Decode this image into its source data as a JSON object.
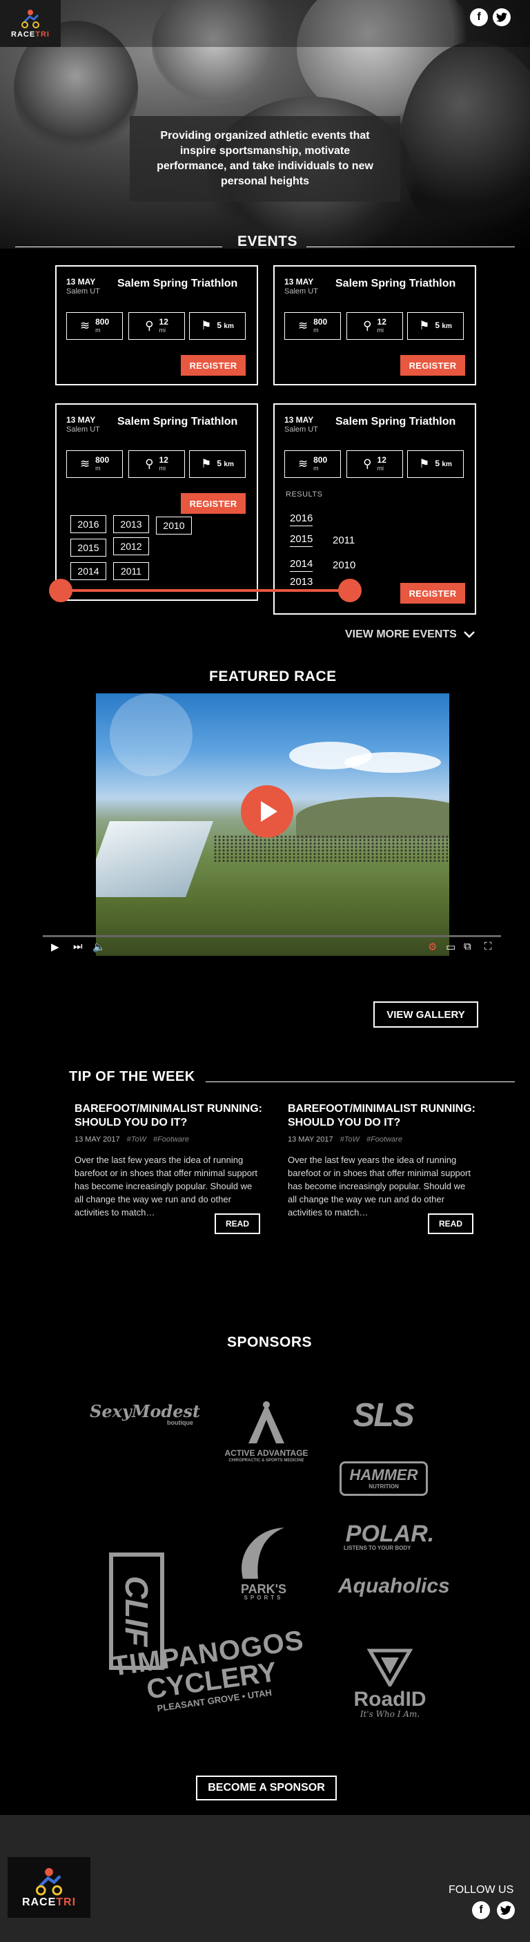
{
  "header": {
    "logo_text_a": "RACE",
    "logo_text_b": "TRI",
    "social": [
      {
        "name": "facebook",
        "glyph": "f"
      },
      {
        "name": "twitter",
        "glyph": "t"
      }
    ]
  },
  "hero": {
    "mission": "Providing organized athletic events that inspire sportsmanship, motivate performance, and take individuals to new personal heights"
  },
  "events": {
    "title": "EVENTS",
    "cards": [
      {
        "date": "13 MAY",
        "location": "Salem UT",
        "name": "Salem Spring Triathlon",
        "swim": "800",
        "swim_unit": "m",
        "bike": "12",
        "bike_unit": "mi",
        "run": "5",
        "run_unit": "km",
        "register": "REGISTER"
      },
      {
        "date": "13 MAY",
        "location": "Salem UT",
        "name": "Salem Spring Triathlon",
        "swim": "800",
        "swim_unit": "m",
        "bike": "12",
        "bike_unit": "mi",
        "run": "5",
        "run_unit": "km",
        "register": "REGISTER"
      },
      {
        "date": "13 MAY",
        "location": "Salem UT",
        "name": "Salem Spring Triathlon",
        "swim": "800",
        "swim_unit": "m",
        "bike": "12",
        "bike_unit": "mi",
        "run": "5",
        "run_unit": "km",
        "register": "REGISTER"
      },
      {
        "date": "13 MAY",
        "location": "Salem UT",
        "name": "Salem Spring Triathlon",
        "swim": "800",
        "swim_unit": "m",
        "bike": "12",
        "bike_unit": "mi",
        "run": "5",
        "run_unit": "km",
        "register": "REGISTER"
      }
    ],
    "year_boxes": [
      "2016",
      "2013",
      "2010",
      "2015",
      "2012",
      "2014",
      "2011"
    ],
    "results_label": "RESULTS",
    "results_years": [
      "2016",
      "2015",
      "2011",
      "2014",
      "2010",
      "2013"
    ],
    "view_more": "VIEW MORE EVENTS"
  },
  "featured": {
    "title": "FEATURED RACE",
    "controls": {
      "play": "▶",
      "next": "⏭",
      "volume": "🔈",
      "settings": "⚙",
      "subtitles": "▭",
      "cast": "⧉",
      "fullscreen": "⛶"
    },
    "gallery_button": "VIEW GALLERY"
  },
  "tips": {
    "title": "TIP OF THE WEEK",
    "items": [
      {
        "title": "BAREFOOT/MINIMALIST RUNNING: SHOULD YOU DO IT?",
        "date": "13 MAY 2017",
        "tag1": "#ToW",
        "tag2": "#Footware",
        "body": "Over the last few years the idea of running barefoot or in shoes that offer minimal support has become increasingly popular. Should we all change the way we run and do other activities to match…",
        "read": "READ"
      },
      {
        "title": "BAREFOOT/MINIMALIST RUNNING: SHOULD YOU DO IT?",
        "date": "13 MAY 2017",
        "tag1": "#ToW",
        "tag2": "#Footware",
        "body": "Over the last few years the idea of running barefoot or in shoes that offer minimal support has become increasingly popular. Should we all change the way we run and do other activities to match…",
        "read": "READ"
      }
    ]
  },
  "sponsors": {
    "title": "SPONSORS",
    "logos": {
      "sexy_modest": "SexyModest",
      "sexy_modest_sub": "boutique",
      "active_adv": "ACTIVE ADVANTAGE",
      "active_adv_sub": "CHIROPRACTIC & SPORTS MEDICINE",
      "sls": "SLS",
      "hammer": "HAMMER",
      "hammer_sub": "NUTRITION",
      "polar": "POLAR.",
      "polar_sub": "LISTENS TO YOUR BODY",
      "clif": "CLIF",
      "parks": "PARK'S",
      "parks_sub": "SPORTS",
      "aquaholics": "Aquaholics",
      "timp": "TIMPANOGOS",
      "timp2": "CYCLERY",
      "timp_sub": "PLEASANT GROVE • UTAH",
      "roadid": "RoadID",
      "roadid_sub": "It's Who I Am."
    },
    "become_button": "BECOME A SPONSOR"
  },
  "footer": {
    "logo_text_a": "RACE",
    "logo_text_b": "TRI",
    "follow": "FOLLOW US"
  },
  "colors": {
    "accent": "#e8573f",
    "background": "#000000",
    "footer": "#262626"
  }
}
